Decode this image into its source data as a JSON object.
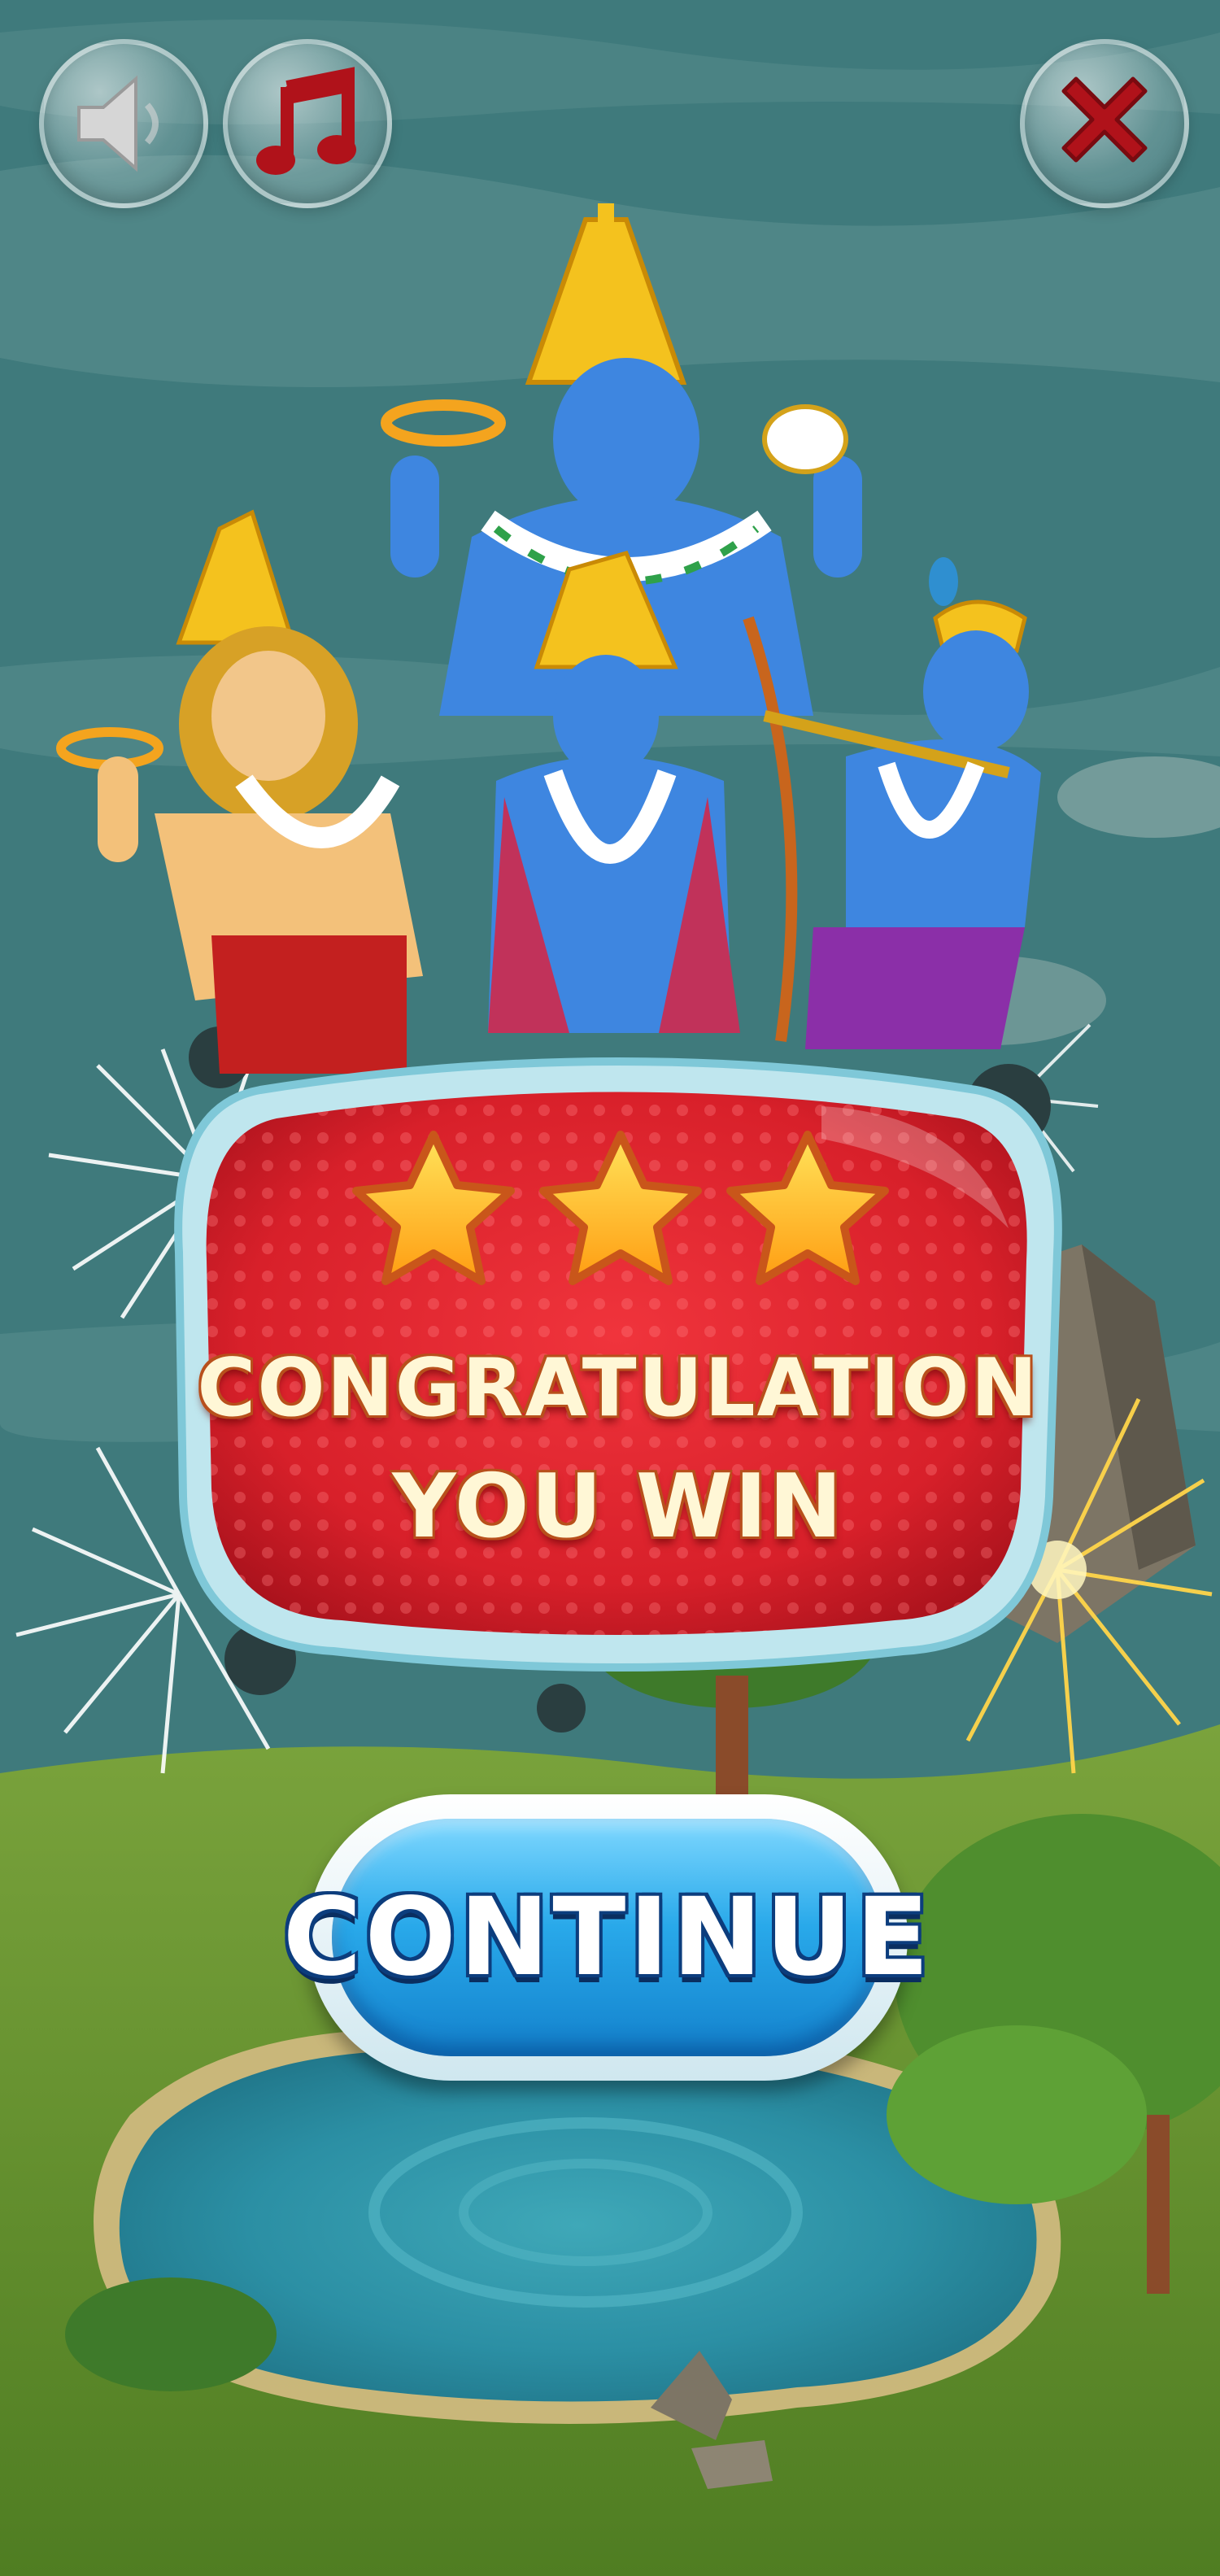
{
  "hud": {
    "sound_icon": "speaker-icon",
    "music_icon": "music-note-icon",
    "close_icon": "close-x-icon"
  },
  "result": {
    "stars_earned": 3,
    "stars_total": 3,
    "line1": "CONGRATULATION",
    "line2": "YOU WIN"
  },
  "continue_button": {
    "label": "CONTINUE"
  },
  "colors": {
    "sky": "#3f7a7c",
    "panel_red": "#d8202a",
    "panel_border": "#8fd3e0",
    "star": "#ffc21a",
    "button_blue": "#29a9ea",
    "icon_red": "#b0121a"
  }
}
